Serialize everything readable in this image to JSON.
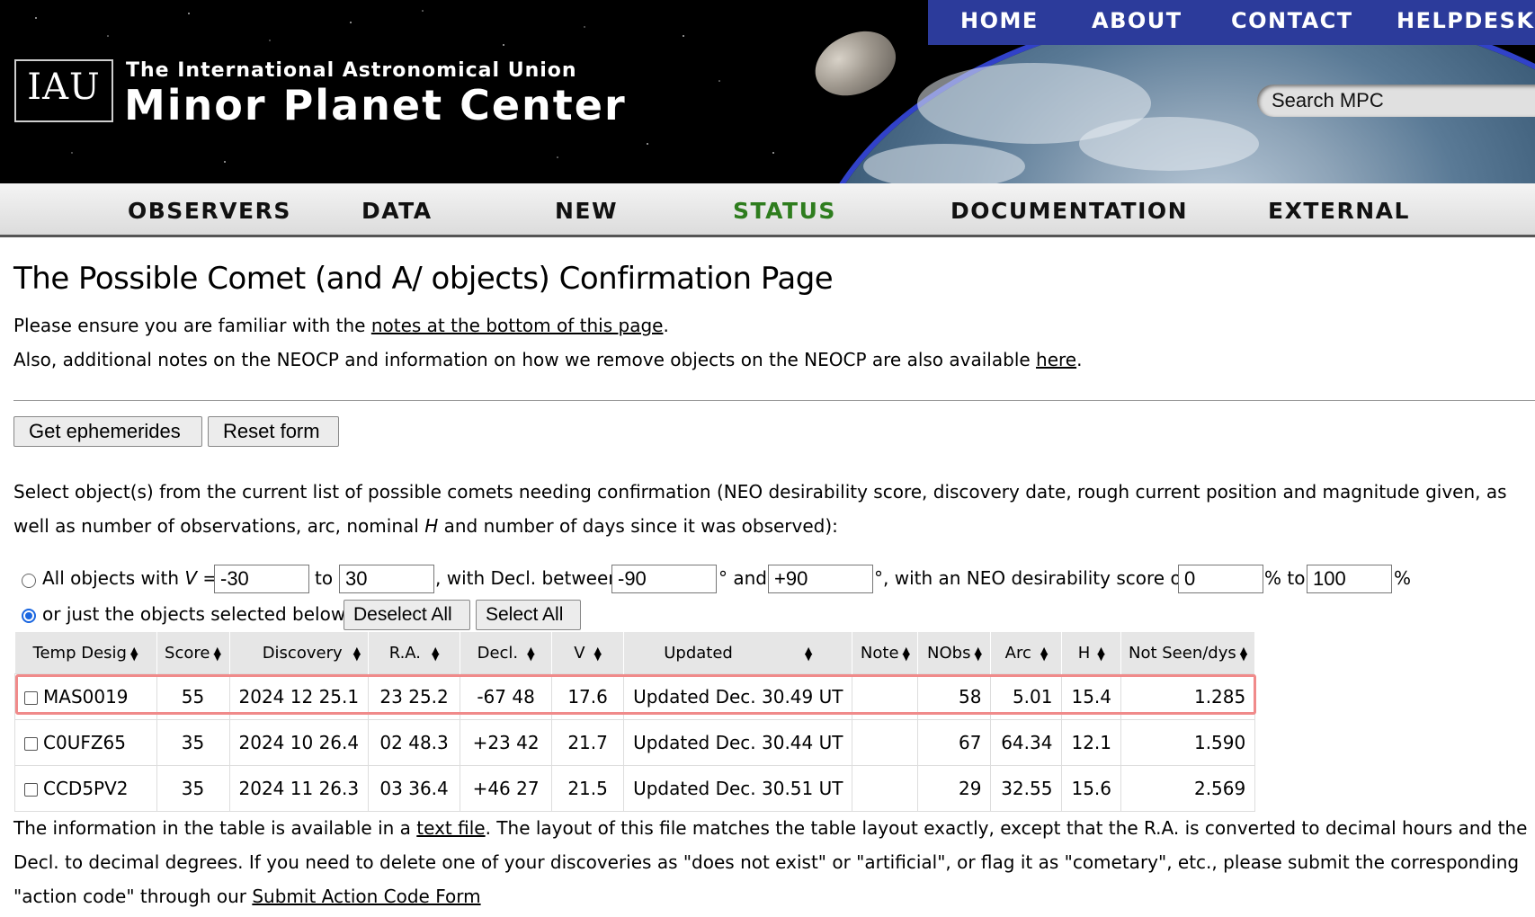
{
  "header": {
    "logo_text": "IAU",
    "org_line1": "The International Astronomical Union",
    "org_line2": "Minor Planet Center",
    "topnav": [
      "HOME",
      "ABOUT",
      "CONTACT",
      "HELPDESK"
    ],
    "search_placeholder": "Search MPC"
  },
  "mainnav": [
    "OBSERVERS",
    "DATA",
    "NEW",
    "STATUS",
    "DOCUMENTATION",
    "EXTERNAL"
  ],
  "active_nav": "STATUS",
  "colors": {
    "topnav_bg": "#2c3b9b",
    "active_nav": "#2e7d1e",
    "highlight_border": "#f08a8a",
    "radio_selected": "#1a66e0"
  },
  "page": {
    "title": "The Possible Comet (and A/ objects) Confirmation Page",
    "p1_prefix": "Please ensure you are familiar with the ",
    "p1_link": "notes at the bottom of this page",
    "p1_suffix": ".",
    "p2_prefix": "Also, additional notes on the NEOCP and information on how we remove objects on the NEOCP are also available ",
    "p2_link": "here",
    "p2_suffix": ".",
    "buttons": {
      "get_ephemerides": "Get ephemerides",
      "reset_form": "Reset form"
    },
    "intro_a": "Select object(s) from the current list of possible comets needing confirmation (NEO desirability score, discovery date, rough current position and magnitude given, as well as number of observations, arc, nominal ",
    "intro_h": "H",
    "intro_b": " and number of days since it was observed):"
  },
  "filter": {
    "all_label_a": "All objects with ",
    "all_label_v": "V",
    "all_label_b": " = ",
    "v_min": "-30",
    "to1": "to",
    "v_max": "30",
    "decl_label": ", with Decl. between",
    "decl_min": "-90",
    "and_label": "° and",
    "decl_max": "+90",
    "score_label": "°, with an NEO desirability score of",
    "score_min": "0",
    "pct_to": "% to",
    "score_max": "100",
    "pct": "%",
    "selected_label": "or just the objects selected below:",
    "deselect_all": "Deselect All",
    "select_all": "Select All",
    "mode": "selected"
  },
  "table": {
    "columns": [
      "Temp Desig",
      "Score",
      "Discovery",
      "R.A.",
      "Decl.",
      "V",
      "Updated",
      "Note",
      "NObs",
      "Arc",
      "H",
      "Not Seen/dys"
    ],
    "rows": [
      {
        "desig": "MAS0019",
        "score": "55",
        "discovery": "2024 12 25.1",
        "ra": "23 25.2",
        "decl": "-67 48",
        "v": "17.6",
        "updated": "Updated Dec. 30.49 UT",
        "note": "",
        "nobs": "58",
        "arc": "5.01",
        "h": "15.4",
        "notseen": "1.285",
        "highlighted": true
      },
      {
        "desig": "C0UFZ65",
        "score": "35",
        "discovery": "2024 10 26.4",
        "ra": "02 48.3",
        "decl": "+23 42",
        "v": "21.7",
        "updated": "Updated Dec. 30.44 UT",
        "note": "",
        "nobs": "67",
        "arc": "64.34",
        "h": "12.1",
        "notseen": "1.590",
        "highlighted": false
      },
      {
        "desig": "CCD5PV2",
        "score": "35",
        "discovery": "2024 11 26.3",
        "ra": "03 36.4",
        "decl": "+46 27",
        "v": "21.5",
        "updated": "Updated Dec. 30.51 UT",
        "note": "",
        "nobs": "29",
        "arc": "32.55",
        "h": "15.6",
        "notseen": "2.569",
        "highlighted": false
      }
    ]
  },
  "footer": {
    "a": "The information in the table is available in a ",
    "link1": "text file",
    "b": ". The layout of this file matches the table layout exactly, except that the R.A. is converted to decimal hours and the Decl. to decimal degrees. If you need to delete one of your discoveries as \"does not exist\" or \"artificial\", or flag it as \"cometary\", etc., please submit the corresponding \"action code\" through our ",
    "link2": "Submit Action Code Form"
  }
}
